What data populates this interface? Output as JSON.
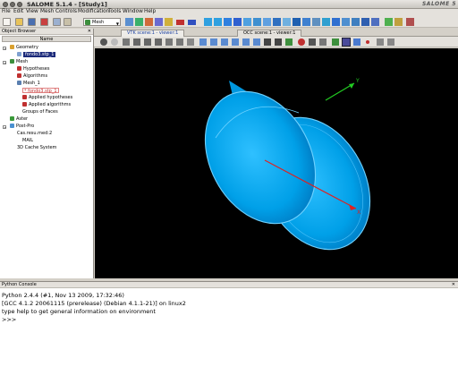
{
  "window": {
    "title": "SALOME 5.1.4 - [Study1]",
    "logo": "SALOME 5"
  },
  "menu": [
    "File",
    "Edit",
    "View",
    "Mesh",
    "Controls",
    "Modification",
    "Tools",
    "Window",
    "Help"
  ],
  "toolbar": {
    "module": "Mesh"
  },
  "object_browser": {
    "title": "Object Browser",
    "column": "Name",
    "nodes": [
      "Geometry",
      "fondo3.stp_1",
      "Mesh",
      "Hypotheses",
      "Algorithms",
      "Mesh_1",
      "* fondo3.stp_1",
      "Applied hypotheses",
      "Applied algorithms",
      "Groups of Faces",
      "Aster",
      "Post-Pro",
      "Cas.resu.med:2",
      "MAIL",
      "3D Cache System"
    ]
  },
  "view_tabs": [
    "VTK scene:1 - viewer:1",
    "OCC scene:1 - viewer:1"
  ],
  "viewport": {
    "axis_y": "Y",
    "axis_x": "X"
  },
  "console": {
    "title": "Python Console",
    "lines": [
      "Python 2.4.4 (#1, Nov 13 2009, 17:32:46)",
      "[GCC 4.1.2 20061115 (prerelease) (Debian 4.1.1-21)] on linux2",
      "type help to get general information on environment",
      ">>>"
    ]
  },
  "colors": {
    "mesh_fill": "#00a8f0",
    "edge": "#6fd2ff",
    "axis_y": "#22cc22",
    "axis_x": "#dd2222",
    "selection": "#1b2a7a"
  }
}
